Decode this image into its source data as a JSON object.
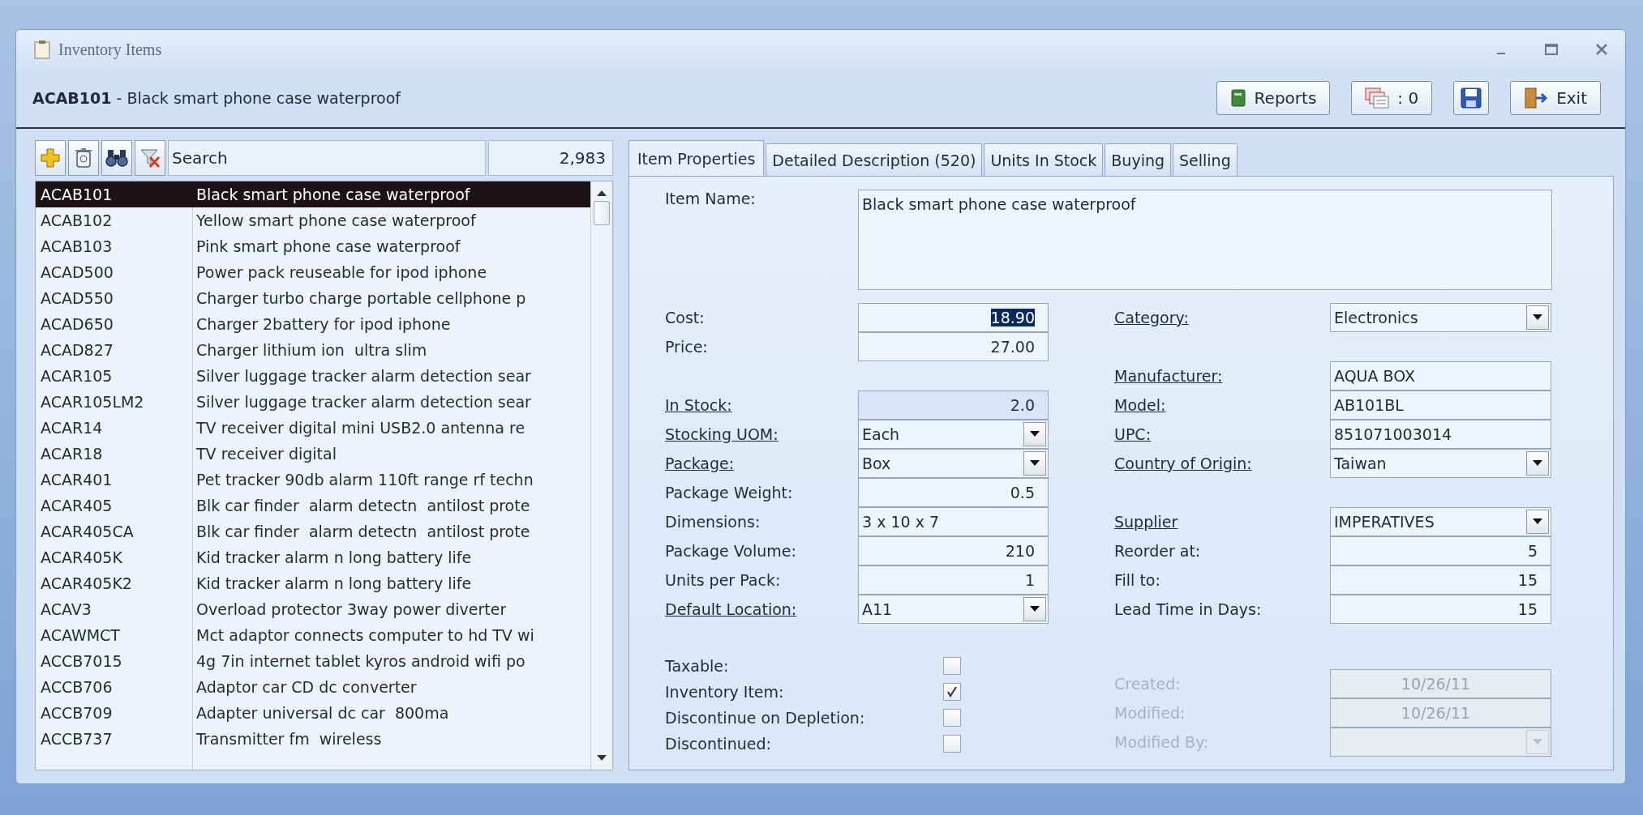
{
  "window": {
    "title": "Inventory Items"
  },
  "header": {
    "title": "**ACAB101** - Black smart phone case waterproof",
    "buttons": [
      {
        "kind": "reports",
        "label": "Reports"
      },
      {
        "kind": "count",
        "label": ": 0"
      },
      {
        "kind": "save"
      },
      {
        "kind": "exit",
        "label": "Exit"
      }
    ]
  },
  "toolbar": {
    "tools": [
      {
        "kind": "add"
      },
      {
        "kind": "delete"
      },
      {
        "kind": "find"
      },
      {
        "kind": "clear-filter"
      }
    ],
    "search": {
      "placeholder": "Search"
    },
    "count": "2,983"
  },
  "items": [
    {
      "code": "ACAB101",
      "description": "Black smart phone case waterproof",
      "selected": true
    },
    {
      "code": "ACAB102",
      "description": "Yellow smart phone case waterproof",
      "selected": false
    },
    {
      "code": "ACAB103",
      "description": "Pink smart phone case waterproof",
      "selected": false
    },
    {
      "code": "ACAD500",
      "description": "Power pack reuseable for ipod iphone",
      "selected": false
    },
    {
      "code": "ACAD550",
      "description": "Charger turbo charge portable cellphone p",
      "selected": false
    },
    {
      "code": "ACAD650",
      "description": "Charger 2battery for ipod iphone",
      "selected": false
    },
    {
      "code": "ACAD827",
      "description": "Charger lithium ion  ultra slim",
      "selected": false
    },
    {
      "code": "ACAR105",
      "description": "Silver luggage tracker alarm detection sear",
      "selected": false
    },
    {
      "code": "ACAR105LM2",
      "description": "Silver luggage tracker alarm detection sear",
      "selected": false
    },
    {
      "code": "ACAR14",
      "description": "TV receiver digital mini USB2.0 antenna re",
      "selected": false
    },
    {
      "code": "ACAR18",
      "description": "TV receiver digital",
      "selected": false
    },
    {
      "code": "ACAR401",
      "description": "Pet tracker 90db alarm 110ft range rf techn",
      "selected": false
    },
    {
      "code": "ACAR405",
      "description": "Blk car finder  alarm detectn  antilost prote",
      "selected": false
    },
    {
      "code": "ACAR405CA",
      "description": "Blk car finder  alarm detectn  antilost prote",
      "selected": false
    },
    {
      "code": "ACAR405K",
      "description": "Kid tracker alarm n long battery life",
      "selected": false
    },
    {
      "code": "ACAR405K2",
      "description": "Kid tracker alarm n long battery life",
      "selected": false
    },
    {
      "code": "ACAV3",
      "description": "Overload protector 3way power diverter",
      "selected": false
    },
    {
      "code": "ACAWMCT",
      "description": "Mct adaptor connects computer to hd TV wi",
      "selected": false
    },
    {
      "code": "ACCB7015",
      "description": "4g 7in internet tablet kyros android wifi po",
      "selected": false
    },
    {
      "code": "ACCB706",
      "description": "Adaptor car CD dc converter",
      "selected": false
    },
    {
      "code": "ACCB709",
      "description": "Adapter universal dc car  800ma",
      "selected": false
    },
    {
      "code": "ACCB737",
      "description": "Transmitter fm  wireless",
      "selected": false
    }
  ],
  "tabs": [
    {
      "label": "Item Properties",
      "selected": true
    },
    {
      "label": "Detailed Description (520)",
      "selected": false
    },
    {
      "label": "Units In Stock",
      "selected": false
    },
    {
      "label": "Buying",
      "selected": false
    },
    {
      "label": "Selling",
      "selected": false
    }
  ],
  "form": {
    "item_name": {
      "label": "Item Name:",
      "value": "Black smart phone case waterproof"
    },
    "left_groups": [
      [
        {
          "label": "Cost:",
          "value": "18.90",
          "kind": "number",
          "underlined": false,
          "disabled": false,
          "text_selected": true
        },
        {
          "label": "Price:",
          "value": "27.00",
          "kind": "number",
          "underlined": false,
          "disabled": false,
          "text_selected": false
        }
      ],
      [
        {
          "label": "In Stock:",
          "value": "2.0",
          "kind": "readonly",
          "underlined": true,
          "disabled": false,
          "text_selected": false
        },
        {
          "label": "Stocking UOM:",
          "value": "Each",
          "kind": "combo",
          "underlined": true,
          "disabled": false,
          "text_selected": false
        },
        {
          "label": "Package:",
          "value": "Box",
          "kind": "combo",
          "underlined": true,
          "disabled": false,
          "text_selected": false
        },
        {
          "label": "Package Weight:",
          "value": "0.5",
          "kind": "number",
          "underlined": false,
          "disabled": false,
          "text_selected": false
        },
        {
          "label": "Dimensions:",
          "value": "3 x 10 x 7",
          "kind": "text",
          "underlined": false,
          "disabled": false,
          "text_selected": false
        },
        {
          "label": "Package Volume:",
          "value": "210",
          "kind": "number",
          "underlined": false,
          "disabled": false,
          "text_selected": false
        },
        {
          "label": "Units per Pack:",
          "value": "1",
          "kind": "number",
          "underlined": false,
          "disabled": false,
          "text_selected": false
        },
        {
          "label": "Default Location:",
          "value": "A11",
          "kind": "combo",
          "underlined": true,
          "disabled": false,
          "text_selected": false
        }
      ]
    ],
    "checkboxes": [
      {
        "label": "Taxable:",
        "checked": false
      },
      {
        "label": "Inventory Item:",
        "checked": true
      },
      {
        "label": "Discontinue on Depletion:",
        "checked": false
      },
      {
        "label": "Discontinued:",
        "checked": false
      }
    ],
    "right_groups": [
      [
        {
          "label": "Category:",
          "value": "Electronics",
          "kind": "combo",
          "underlined": true,
          "disabled": false,
          "text_selected": false
        }
      ],
      [
        {
          "label": "Manufacturer:",
          "value": "AQUA BOX",
          "kind": "text",
          "underlined": true,
          "disabled": false,
          "text_selected": false
        },
        {
          "label": "Model:",
          "value": "AB101BL",
          "kind": "text",
          "underlined": true,
          "disabled": false,
          "text_selected": false
        },
        {
          "label": "UPC:",
          "value": "851071003014",
          "kind": "text",
          "underlined": true,
          "disabled": false,
          "text_selected": false
        },
        {
          "label": "Country of Origin:",
          "value": "Taiwan",
          "kind": "combo",
          "underlined": true,
          "disabled": false,
          "text_selected": false
        }
      ],
      [
        {
          "label": "Supplier",
          "value": "IMPERATIVES",
          "kind": "combo",
          "underlined": true,
          "disabled": false,
          "text_selected": false
        },
        {
          "label": "Reorder at:",
          "value": "5",
          "kind": "number",
          "underlined": false,
          "disabled": false,
          "text_selected": false
        },
        {
          "label": "Fill to:",
          "value": "15",
          "kind": "number",
          "underlined": false,
          "disabled": false,
          "text_selected": false
        },
        {
          "label": "Lead Time in Days:",
          "value": "15",
          "kind": "number",
          "underlined": false,
          "disabled": false,
          "text_selected": false
        }
      ],
      [
        {
          "label": "Created:",
          "value": "10/26/11",
          "kind": "date",
          "underlined": false,
          "disabled": true,
          "text_selected": false
        },
        {
          "label": "Modified:",
          "value": "10/26/11",
          "kind": "date",
          "underlined": false,
          "disabled": true,
          "text_selected": false
        },
        {
          "label": "Modified By:",
          "kind": "combo",
          "underlined": false,
          "disabled": true
        }
      ]
    ]
  }
}
